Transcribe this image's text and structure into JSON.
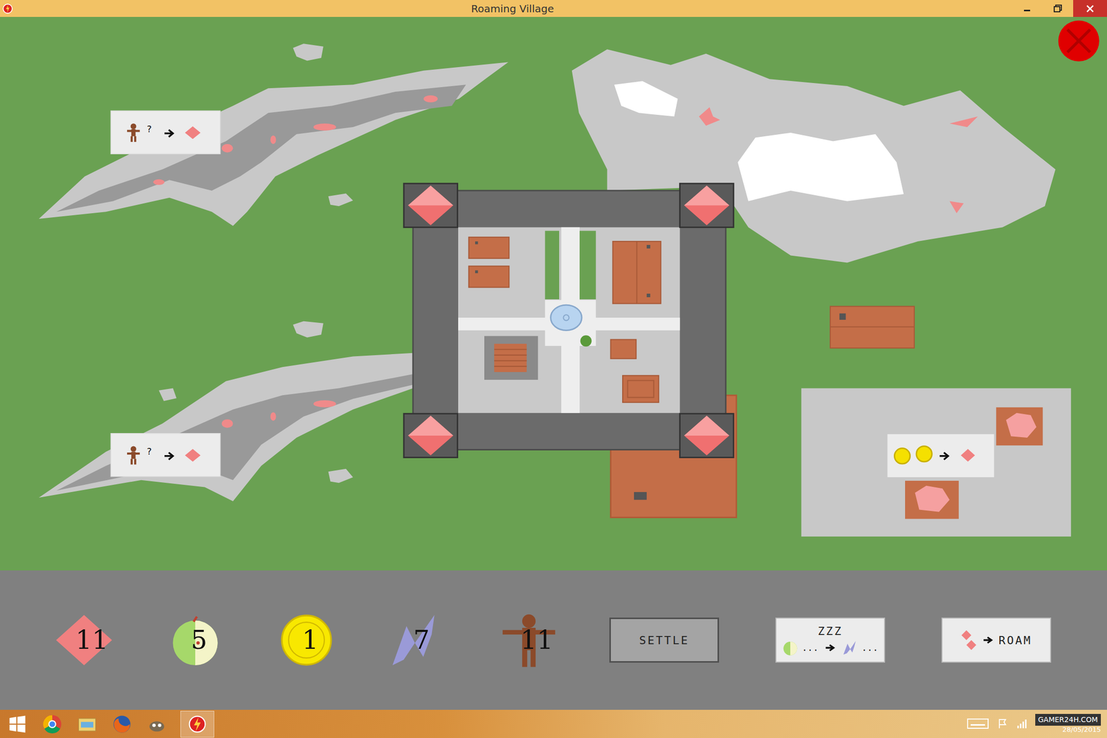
{
  "window": {
    "title": "Roaming Village"
  },
  "map": {
    "mine_signs": [
      {
        "mark": "?"
      },
      {
        "mark": "?"
      }
    ]
  },
  "resources": [
    {
      "kind": "gem",
      "value": "11"
    },
    {
      "kind": "food",
      "value": "5"
    },
    {
      "kind": "gold",
      "value": "1"
    },
    {
      "kind": "energy",
      "value": "7"
    },
    {
      "kind": "people",
      "value": "11"
    }
  ],
  "actions": [
    {
      "kind": "settle",
      "label": "SETTLE"
    },
    {
      "kind": "sleep",
      "label": "ZZZ",
      "from": "...",
      "to": "..."
    },
    {
      "kind": "roam",
      "label": "ROAM"
    }
  ],
  "taskbar": {
    "watermark": "GAMER24H.COM",
    "date": "28/05/2015"
  }
}
